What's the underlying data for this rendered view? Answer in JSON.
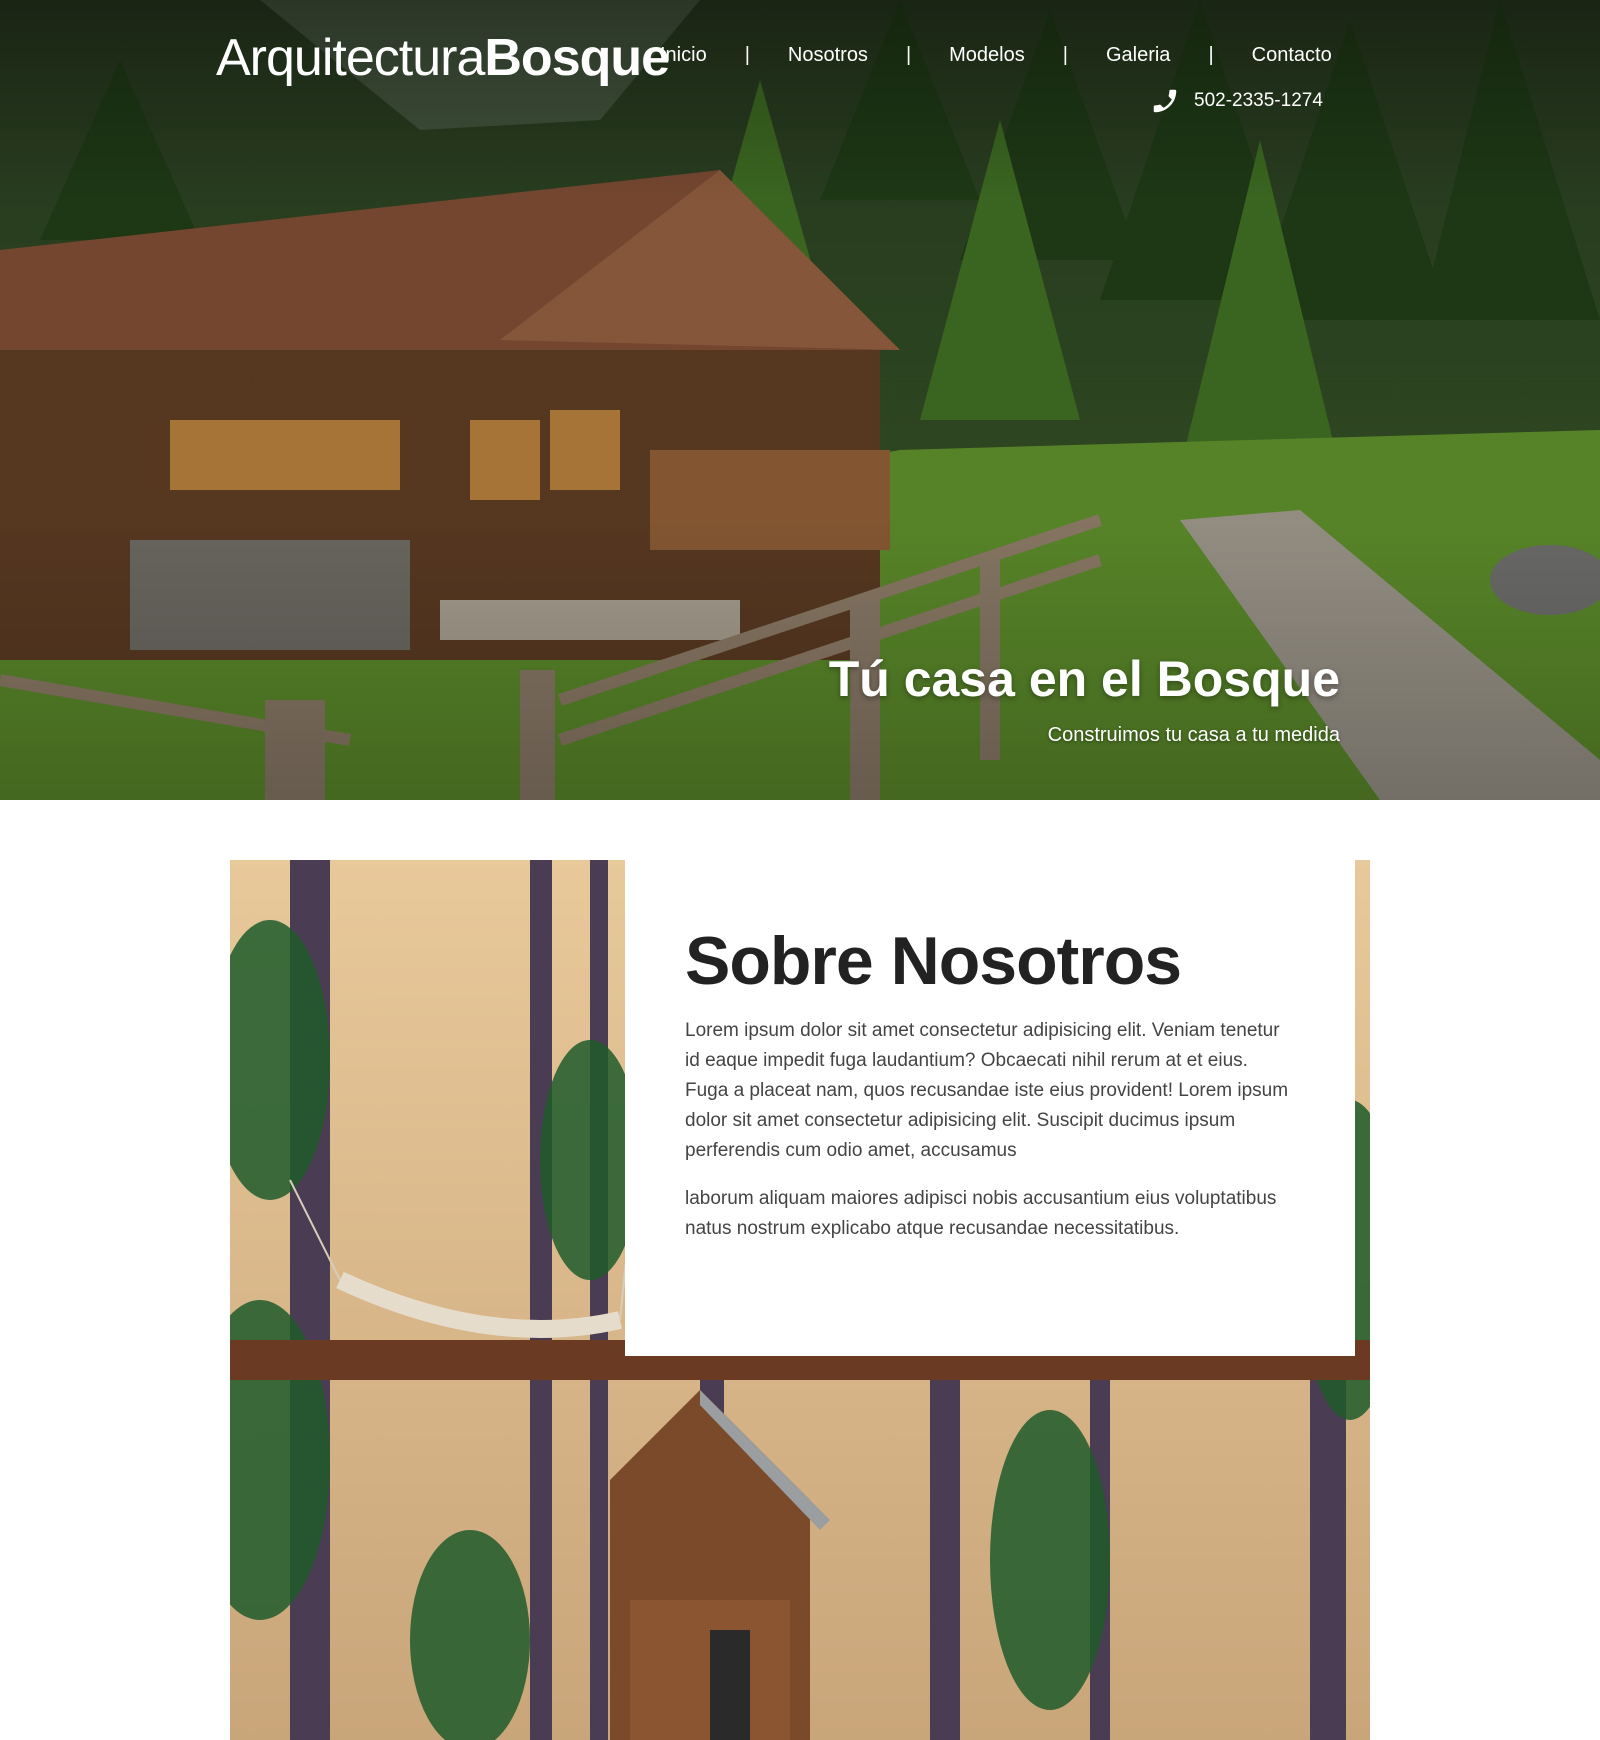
{
  "header": {
    "logo_light": "Arquitectura",
    "logo_bold": "Bosque",
    "nav": {
      "items": [
        "Inicio",
        "Nosotros",
        "Modelos",
        "Galeria",
        "Contacto"
      ],
      "separator": "|"
    },
    "phone": "502-2335-1274"
  },
  "hero": {
    "title": "Tú casa en el Bosque",
    "subtitle": "Construimos tu casa a tu medida"
  },
  "about": {
    "title": "Sobre Nosotros",
    "paragraphs": [
      "Lorem ipsum dolor sit amet consectetur adipisicing elit. Veniam tenetur id eaque impedit fuga laudantium? Obcaecati nihil rerum at et eius. Fuga a placeat nam, quos recusandae iste eius provident! Lorem ipsum dolor sit amet consectetur adipisicing elit. Suscipit ducimus ipsum perferendis cum odio amet, accusamus",
      "laborum aliquam maiores adipisci nobis accusantium eius voluptatibus natus nostrum explicabo atque recusandae necessitatibus."
    ]
  },
  "colors": {
    "text_dark": "#222222",
    "text_body": "#444444",
    "white": "#ffffff"
  }
}
